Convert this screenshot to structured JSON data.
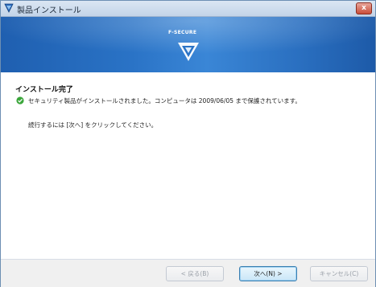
{
  "window": {
    "title": "製品インストール",
    "close_label": "x"
  },
  "banner": {
    "brand_text": "F-SECURE"
  },
  "main": {
    "heading": "インストール完了",
    "status_message": "セキュリティ製品がインストールされました。コンピュータは 2009/06/05 まで保護されています。",
    "instruction": "続行するには [次へ] をクリックしてください。"
  },
  "buttons": {
    "back": "< 戻る(B)",
    "next": "次へ(N) >",
    "cancel": "キャンセル(C)"
  },
  "colors": {
    "accent": "#2a73c6",
    "success": "#3aa63a",
    "close": "#c94d39"
  },
  "icons": {
    "title": "shield-icon",
    "check": "check-icon",
    "logo": "fsecure-logo-icon"
  }
}
